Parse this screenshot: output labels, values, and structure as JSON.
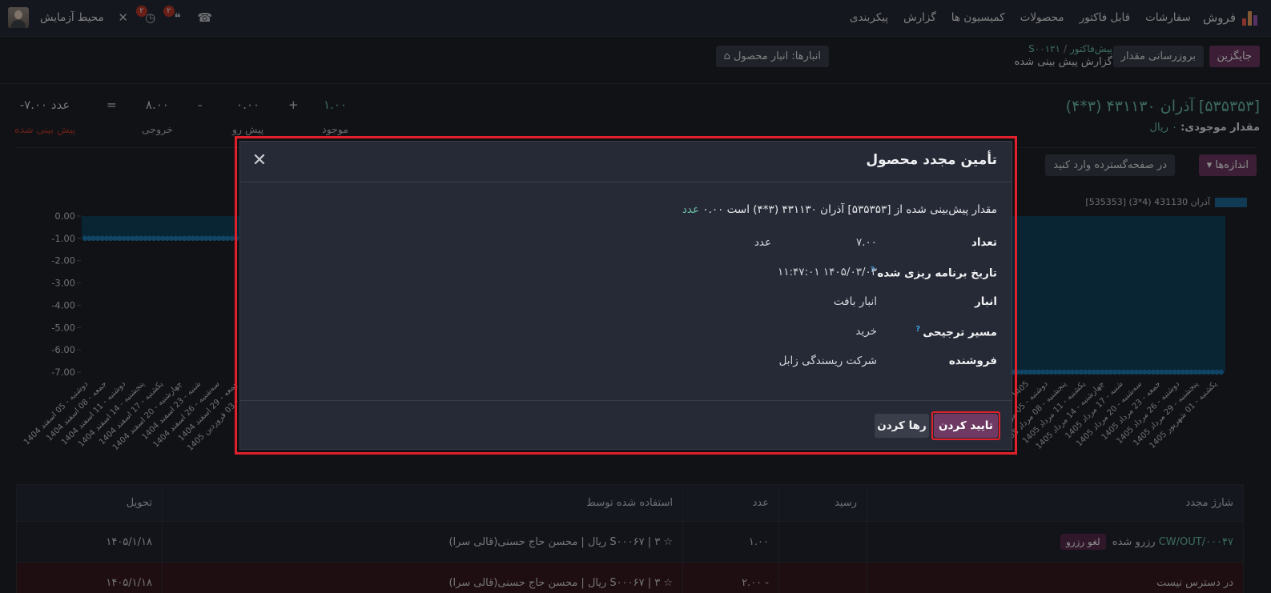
{
  "nav": {
    "app_name": "فروش",
    "menu": [
      "سفارشات",
      "قابل فاکتور",
      "محصولات",
      "کمیسیون ها",
      "گزارش",
      "پیکربندی"
    ],
    "company": "محیط آزمایش",
    "activity_badge": "۲",
    "chat_badge": "۲"
  },
  "control": {
    "replace_label": "جایگزین",
    "update_qty_label": "بروزرسانی مقدار",
    "bc_parent": "پیش‌فاکتور",
    "bc_record": "S۰۰۱۲۱",
    "bc_current": "گزارش پیش بینی شده",
    "warehouse_label": "انبارها: انبار محصول"
  },
  "product": {
    "title": "[۵۳۵۳۵۳] آذران ۴۳۱۱۳۰ (۳*۴)",
    "onhand_label": "مقدار موجودی:",
    "onhand_value": "۰ ریال"
  },
  "forecast": {
    "on_hand": "۱.۰۰",
    "on_hand_label": "موجود",
    "plus": "+",
    "incoming": "۰.۰۰",
    "incoming_label": "پیش رو",
    "minus": "-",
    "outgoing": "۸.۰۰",
    "outgoing_label": "خروجی",
    "equals": "=",
    "forecasted": "-۷.۰۰ عدد",
    "forecasted_label": "پیش بینی شده"
  },
  "filters": {
    "measures_label": "اندازه‌ها",
    "fullscreen_label": "در صفحه‌گسترده وارد کنید"
  },
  "chart_data": {
    "type": "area",
    "legend": "[535353] آذران 431130 (4*3)",
    "y_ticks": [
      "0.00",
      "-1.00",
      "-2.00",
      "-3.00",
      "-4.00",
      "-5.00",
      "-6.00",
      "-7.00"
    ],
    "ylim": [
      -7,
      0
    ],
    "x_left": [
      "دوشنبه - 05 اسفند 1404",
      "جمعه - 08 اسفند 1404",
      "دوشنبه - 11 اسفند 1404",
      "پنجشنبه - 14 اسفند 1404",
      "یکشنبه - 17 اسفند 1404",
      "چهارشنبه - 20 اسفند 1404",
      "شنبه - 23 اسفند 1404",
      "سه‌شنبه - 26 اسفند 1404",
      "جمعه - 29 اسفند 1404",
      "دوشنبه - 03 فروردین 1405"
    ],
    "x_right": [
      "... - 05 ... 1405",
      "دوشنبه - 05 مرداد 1405",
      "پنجشنبه - 08 مرداد 1405",
      "یکشنبه - 11 مرداد 1405",
      "چهارشنبه - 14 مرداد 1405",
      "شنبه - 17 مرداد 1405",
      "سه‌شنبه - 20 مرداد 1405",
      "جمعه - 23 مرداد 1405",
      "دوشنبه - 26 مرداد 1405",
      "پنجشنبه - 29 مرداد 1405",
      "یکشنبه - 01 شهریور 1405"
    ],
    "left_value": -1,
    "right_value": -7
  },
  "table": {
    "headers": [
      "شارژ مجدد",
      "رسید",
      "عدد",
      "استفاده شده توسط",
      "تحویل"
    ],
    "rows": [
      {
        "ref": "CW/OUT/۰۰۰۴۷",
        "state": "رزرو شده",
        "action": "لغو رزرو",
        "receipt": "",
        "qty": "۱.۰۰",
        "used_by": "☆ ۳ | S۰۰۰۶۷ ریال | محسن حاج حسنی(قالی سرا)",
        "delivery": "۱۴۰۵/۱/۱۸"
      },
      {
        "ref": "در دسترس نیست",
        "state": "",
        "action": "",
        "receipt": "",
        "qty": "- ۲.۰۰",
        "used_by": "☆ ۳ | S۰۰۰۶۷ ریال | محسن حاج حسنی(قالی سرا)",
        "delivery": "۱۴۰۵/۱/۱۸"
      }
    ]
  },
  "modal": {
    "title": "تأمین مجدد محصول",
    "message_prefix": "مقدار پیش‌بینی شده از [۵۳۵۳۵۳] آذران ۴۳۱۱۳۰ (۳*۴) است ۰.۰۰",
    "message_uom": "عدد",
    "qty_label": "تعداد",
    "qty_value": "۷.۰۰",
    "qty_uom": "عدد",
    "date_label": "تاریخ برنامه ریزی شده",
    "date_value": "۱۴۰۵/۰۳/۰۳ ۱۱:۴۷:۰۱",
    "help_mark": "?",
    "warehouse_label": "انبار",
    "warehouse_value": "انبار بافت",
    "route_label": "مسیر ترجیحی",
    "route_value": "خرید",
    "vendor_label": "فروشنده",
    "vendor_value": "شرکت ریسندگی زابل",
    "confirm_label": "تایید کردن",
    "discard_label": "رها کردن"
  }
}
